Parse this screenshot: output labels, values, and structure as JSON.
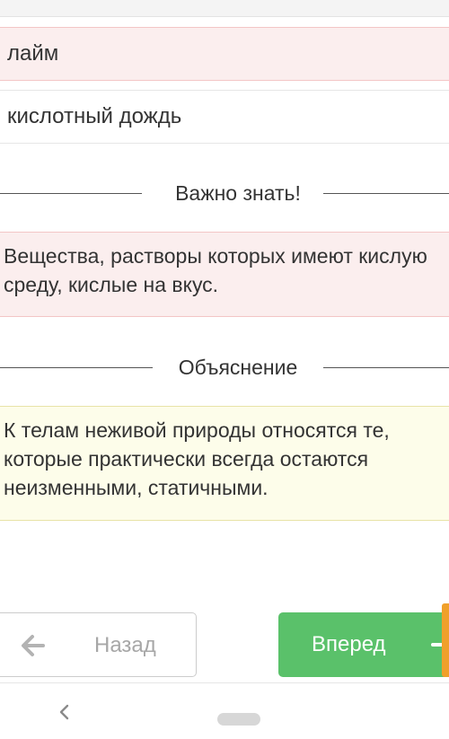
{
  "answers": [
    {
      "text": "лайм",
      "state": "selected"
    },
    {
      "text": "кислотный дождь",
      "state": "plain"
    }
  ],
  "important": {
    "heading": "Важно знать!",
    "body": "Вещества, растворы которых имеют кислую среду, кислые на вкус."
  },
  "explanation": {
    "heading": "Объяснение",
    "body": "К телам неживой природы относятся те, которые практически всегда остаются неизменными, статичными."
  },
  "nav": {
    "back_label": "Назад",
    "next_label": "Вперед",
    "back_icon": "arrow-left-icon",
    "next_icon": "arrow-right-icon"
  },
  "colors": {
    "selected_bg": "#fbeeee",
    "explanation_bg": "#fdfdea",
    "next_button": "#5ac16a",
    "accent_edge": "#f0a02a"
  }
}
